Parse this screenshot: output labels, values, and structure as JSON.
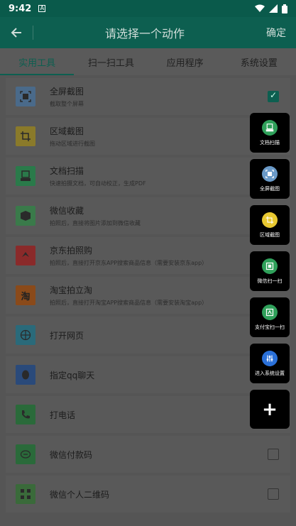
{
  "status": {
    "time": "9:42",
    "app_icon": "A"
  },
  "header": {
    "title": "请选择一个动作",
    "confirm": "确定"
  },
  "tabs": [
    {
      "label": "实用工具",
      "active": true
    },
    {
      "label": "扫一扫工具",
      "active": false
    },
    {
      "label": "应用程序",
      "active": false
    },
    {
      "label": "系统设置",
      "active": false
    }
  ],
  "items": [
    {
      "title": "全屏截图",
      "sub": "截取整个屏幕",
      "icon": "fullscreen-icon",
      "color": "#4a6a8a",
      "checked": true,
      "checkbox": true
    },
    {
      "title": "区域截图",
      "sub": "拖动区域进行截图",
      "icon": "crop-icon",
      "color": "#8a7a2a",
      "checked": false,
      "checkbox": false
    },
    {
      "title": "文档扫描",
      "sub": "快速拍摄文档，可自动校正，生成PDF",
      "icon": "scan-doc-icon",
      "color": "#2a7a4a",
      "checked": false,
      "checkbox": false
    },
    {
      "title": "微信收藏",
      "sub": "拍照后，直接将图片添加到微信收藏",
      "icon": "cube-icon",
      "color": "#3a7a4a",
      "checked": false,
      "checkbox": false
    },
    {
      "title": "京东拍照购",
      "sub": "拍照后，直接打开京东APP搜索商品信息（需要安装京东app）",
      "icon": "jd-icon",
      "color": "#8a2a2a",
      "checked": false,
      "checkbox": false
    },
    {
      "title": "淘宝拍立淘",
      "sub": "拍照后，直接打开淘宝APP搜索商品信息（需要安装淘宝app）",
      "icon": "taobao-icon",
      "color": "#8a4a1a",
      "checked": false,
      "checkbox": false,
      "glyph": "淘"
    },
    {
      "title": "打开网页",
      "sub": "",
      "icon": "globe-icon",
      "color": "#2a6a7a",
      "checked": false,
      "checkbox": false
    },
    {
      "title": "指定qq聊天",
      "sub": "",
      "icon": "qq-icon",
      "color": "#2a4a7a",
      "checked": false,
      "checkbox": false
    },
    {
      "title": "打电话",
      "sub": "",
      "icon": "phone-icon",
      "color": "#2a6a3a",
      "checked": false,
      "checkbox": false
    },
    {
      "title": "微信付款码",
      "sub": "",
      "icon": "wechat-icon",
      "color": "#2a6a3a",
      "checked": false,
      "checkbox": true
    },
    {
      "title": "微信个人二维码",
      "sub": "",
      "icon": "qrcode-icon",
      "color": "#3a6a3a",
      "checked": false,
      "checkbox": true
    }
  ],
  "fabs": [
    {
      "label": "文档扫描",
      "icon": "scan-doc-icon",
      "color": "#2fa05a"
    },
    {
      "label": "全屏截图",
      "icon": "fullscreen-icon",
      "color": "#6a9ac8"
    },
    {
      "label": "区域截图",
      "icon": "crop-icon",
      "color": "#e8c830"
    },
    {
      "label": "微信扫一扫",
      "icon": "wechat-scan-icon",
      "color": "#2fa05a"
    },
    {
      "label": "支付宝扫一扫",
      "icon": "alipay-scan-icon",
      "color": "#2fa05a"
    },
    {
      "label": "进入系统设置",
      "icon": "settings-sliders-icon",
      "color": "#2a70d8"
    }
  ],
  "fab_add": "+"
}
